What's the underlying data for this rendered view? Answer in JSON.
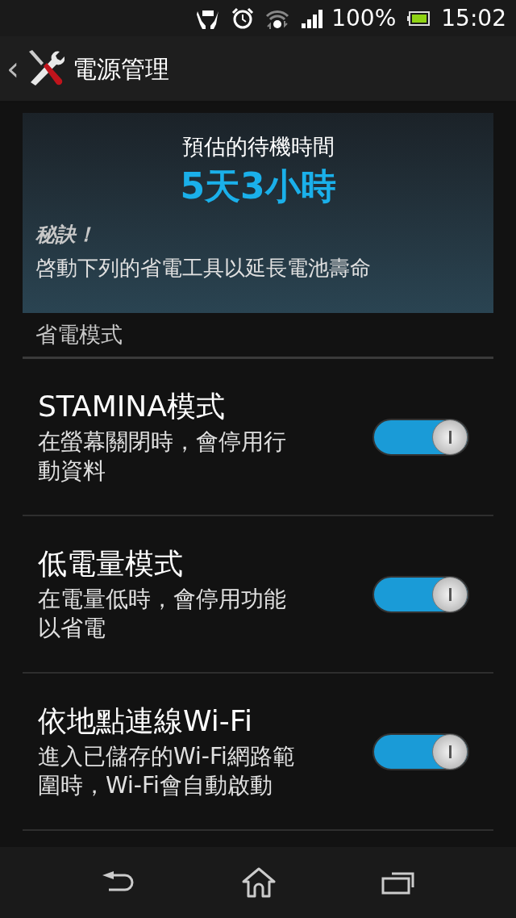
{
  "status_bar": {
    "battery_percent": "100%",
    "time": "15:02"
  },
  "action_bar": {
    "back": "‹",
    "title": "電源管理"
  },
  "estimate_card": {
    "label": "預估的待機時間",
    "value": "5天3小時",
    "tip_title": "秘訣！",
    "tip_text": "啓動下列的省電工具以延長電池壽命"
  },
  "section": {
    "title": "省電模式"
  },
  "settings": [
    {
      "title": "STAMINA模式",
      "description": "在螢幕關閉時，會停用行動資料",
      "on": true
    },
    {
      "title": "低電量模式",
      "description": "在電量低時，會停用功能以省電",
      "on": true
    },
    {
      "title": "依地點連線Wi-Fi",
      "description": "進入已儲存的Wi-Fi網路範圍時，Wi-Fi會自動啟動",
      "on": true
    }
  ]
}
